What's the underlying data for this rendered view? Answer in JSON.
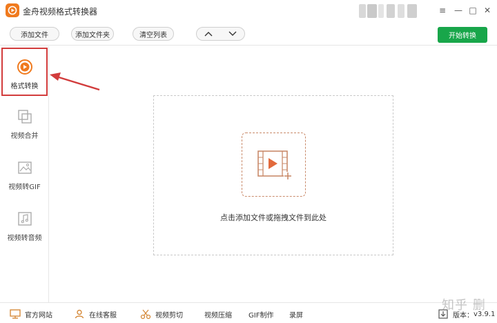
{
  "app": {
    "title": "金舟视频格式转换器",
    "brand_color": "#f07a1e"
  },
  "window_controls": {
    "menu_icon": "≡",
    "minimize_icon": "—",
    "maximize_icon": "□",
    "close_icon": "✕"
  },
  "toolbar": {
    "add_file": "添加文件",
    "add_folder": "添加文件夹",
    "clear_list": "清空列表",
    "start": "开始转换",
    "start_color": "#18a64a"
  },
  "sidebar": {
    "items": [
      {
        "label": "格式转换",
        "icon": "play-circle-icon",
        "active": true
      },
      {
        "label": "视频合并",
        "icon": "merge-icon",
        "active": false
      },
      {
        "label": "视频转GIF",
        "icon": "image-icon",
        "active": false
      },
      {
        "label": "视频转音频",
        "icon": "music-icon",
        "active": false
      }
    ],
    "highlight_color": "#d23c3c"
  },
  "dropzone": {
    "text": "点击添加文件或拖拽文件到此处",
    "icon": "add-video-icon"
  },
  "footer": {
    "items": [
      {
        "label": "官方网站",
        "icon": "monitor-icon"
      },
      {
        "label": "在线客服",
        "icon": "user-icon"
      },
      {
        "label": "视频剪切",
        "icon": "scissors-icon"
      },
      {
        "label": "视频压缩",
        "icon": ""
      },
      {
        "label": "GIF制作",
        "icon": ""
      },
      {
        "label": "录屏",
        "icon": ""
      }
    ],
    "version_label": "版本：",
    "version": "v3.9.1"
  },
  "watermark": "知乎 删"
}
